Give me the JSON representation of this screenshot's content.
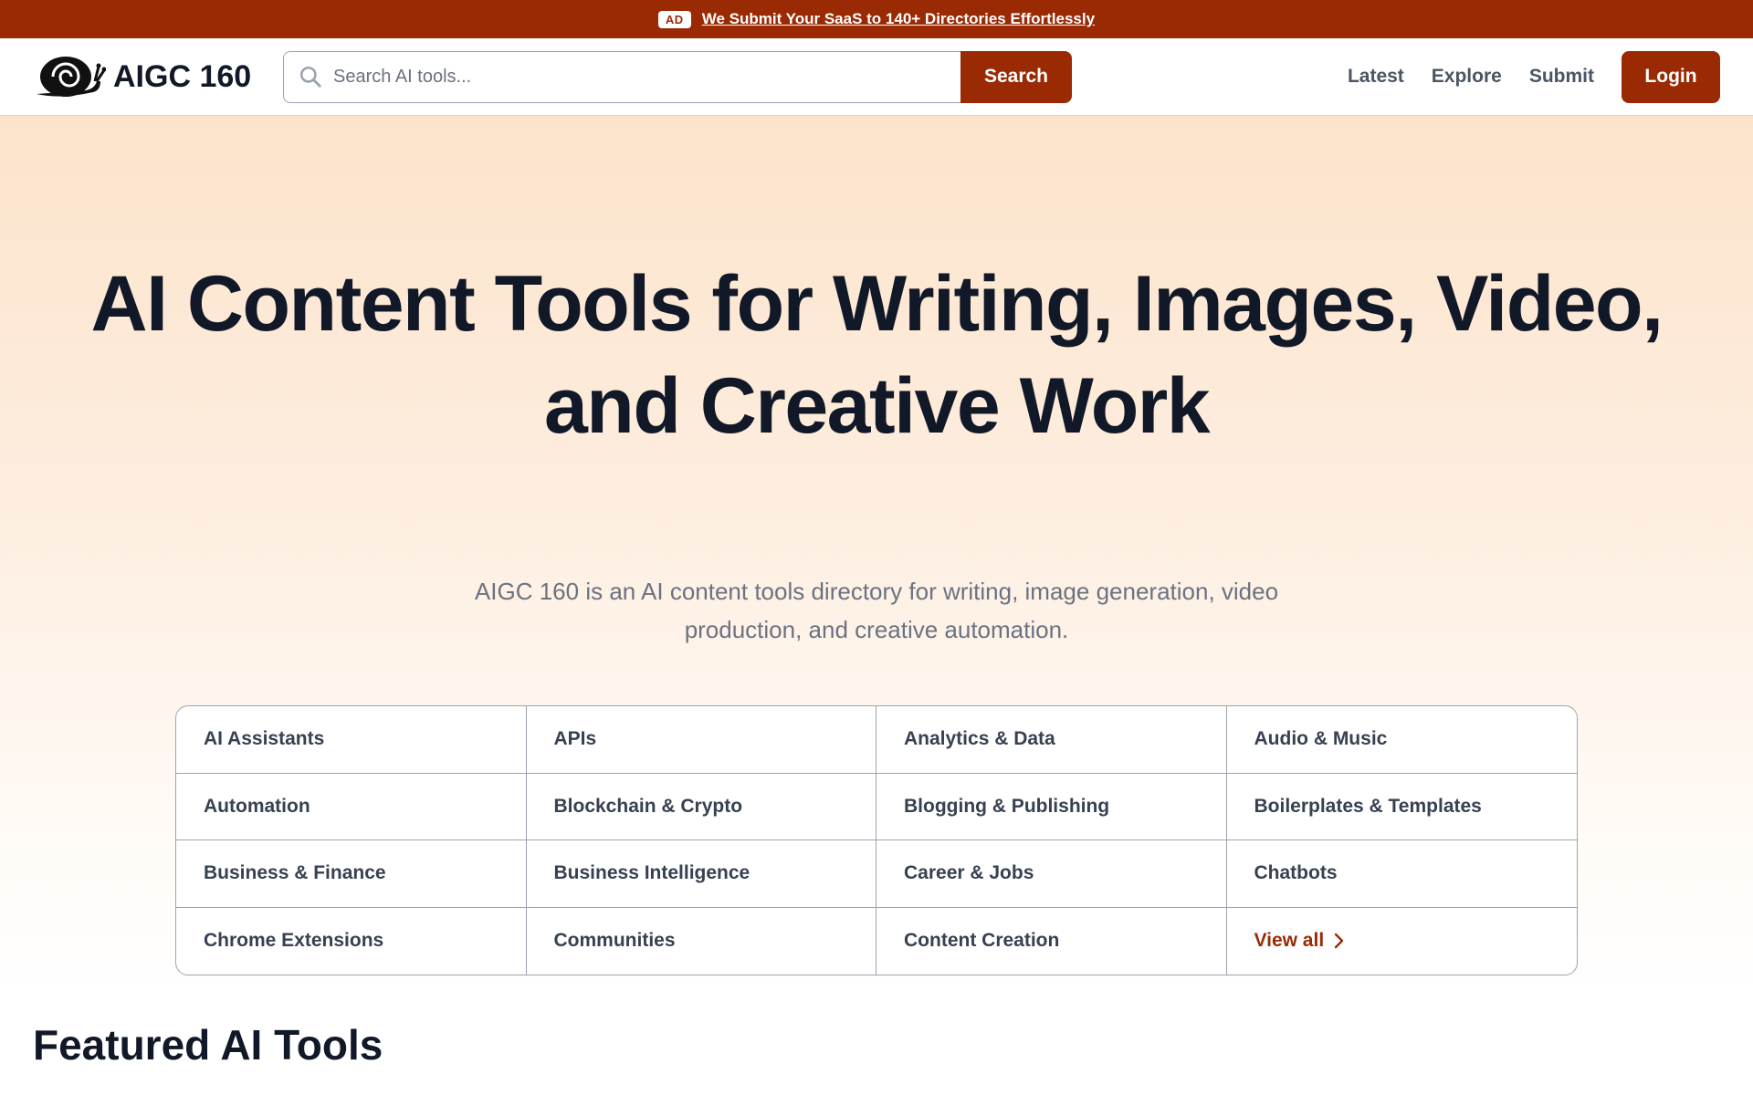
{
  "ad": {
    "badge": "AD",
    "text": "We Submit Your SaaS to 140+ Directories Effortlessly"
  },
  "header": {
    "logo_text": "AIGC 160",
    "search_placeholder": "Search AI tools...",
    "search_button": "Search",
    "nav": [
      "Latest",
      "Explore",
      "Submit"
    ],
    "login_button": "Login"
  },
  "hero": {
    "title_line1": "AI Content Tools for Writing, Images, Video,",
    "title_line2": "and Creative Work",
    "subtitle_line1": "AIGC 160 is an AI content tools directory for writing, image generation, video",
    "subtitle_line2": "production, and creative automation."
  },
  "categories": [
    "AI Assistants",
    "APIs",
    "Analytics & Data",
    "Audio & Music",
    "Automation",
    "Blockchain & Crypto",
    "Blogging & Publishing",
    "Boilerplates & Templates",
    "Business & Finance",
    "Business Intelligence",
    "Career & Jobs",
    "Chatbots",
    "Chrome Extensions",
    "Communities",
    "Content Creation"
  ],
  "view_all": "View all",
  "featured": {
    "title": "Featured AI Tools"
  },
  "colors": {
    "brand": "#9a2a04",
    "text_dark": "#111827",
    "text_muted": "#6b7280"
  }
}
